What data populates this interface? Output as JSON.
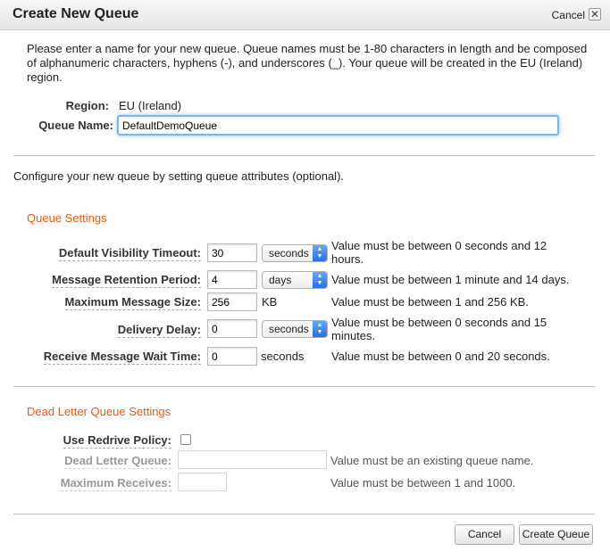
{
  "dialog": {
    "title": "Create New Queue",
    "cancel_link": "Cancel",
    "close_glyph": "✕"
  },
  "intro_text": "Please enter a name for your new queue. Queue names must be 1-80 characters in length and be composed of alphanumeric characters, hyphens (-), and underscores (_). Your queue will be created in the EU (Ireland) region.",
  "region": {
    "label": "Region:",
    "value": "EU (Ireland)"
  },
  "queue_name": {
    "label": "Queue Name:",
    "value": "DefaultDemoQueue"
  },
  "configure_note": "Configure your new queue by setting queue attributes (optional).",
  "queue_settings": {
    "title": "Queue Settings",
    "visibility_timeout": {
      "label": "Default Visibility Timeout:",
      "value": "30",
      "unit": "seconds",
      "hint": "Value must be between 0 seconds and 12 hours."
    },
    "retention_period": {
      "label": "Message Retention Period:",
      "value": "4",
      "unit": "days",
      "hint": "Value must be between 1 minute and 14 days."
    },
    "max_message_size": {
      "label": "Maximum Message Size:",
      "value": "256",
      "unit": "KB",
      "hint": "Value must be between 1 and 256 KB."
    },
    "delivery_delay": {
      "label": "Delivery Delay:",
      "value": "0",
      "unit": "seconds",
      "hint": "Value must be between 0 seconds and 15 minutes."
    },
    "receive_wait_time": {
      "label": "Receive Message Wait Time:",
      "value": "0",
      "unit": "seconds",
      "hint": "Value must be between 0 and 20 seconds."
    }
  },
  "dead_letter_settings": {
    "title": "Dead Letter Queue Settings",
    "redrive": {
      "label": "Use Redrive Policy:",
      "checked": false
    },
    "dead_letter_queue": {
      "label": "Dead Letter Queue:",
      "value": "",
      "hint": "Value must be an existing queue name."
    },
    "max_receives": {
      "label": "Maximum Receives:",
      "value": "",
      "hint": "Value must be between 1 and 1000."
    }
  },
  "footer": {
    "cancel_label": "Cancel",
    "create_label": "Create Queue"
  },
  "colors": {
    "section_title": "#e8590c",
    "focus_ring": "#7fb4ea",
    "select_arrow": "#2b6fe0"
  },
  "icons": {
    "close": "close-icon",
    "select_arrow": "chevron-updown-icon"
  }
}
